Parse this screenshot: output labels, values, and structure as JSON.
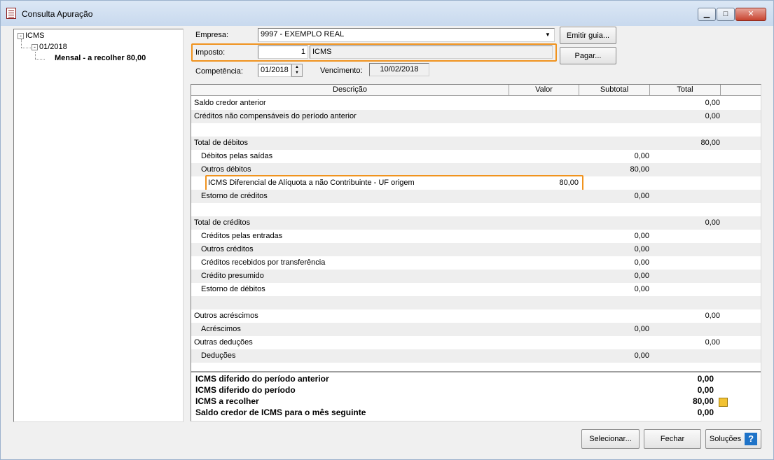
{
  "window": {
    "title": "Consulta Apuração"
  },
  "tree": {
    "root": "ICMS",
    "period": "01/2018",
    "leaf": "Mensal - a recolher 80,00"
  },
  "form": {
    "empresa_label": "Empresa:",
    "empresa_value": "9997 - EXEMPLO REAL",
    "imposto_label": "Imposto:",
    "imposto_code": "1",
    "imposto_name": "ICMS",
    "competencia_label": "Competência:",
    "competencia_value": "01/2018",
    "vencimento_label": "Vencimento:",
    "vencimento_value": "10/02/2018",
    "emitir_guia": "Emitir guia...",
    "pagar": "Pagar..."
  },
  "grid": {
    "columns": [
      "Descrição",
      "Valor",
      "Subtotal",
      "Total"
    ],
    "rows": [
      {
        "desc": "Saldo credor anterior",
        "indent": 0,
        "valor": "",
        "subtotal": "",
        "total": "0,00"
      },
      {
        "desc": "Créditos não compensáveis do período anterior",
        "indent": 0,
        "valor": "",
        "subtotal": "",
        "total": "0,00"
      },
      {
        "desc": "",
        "indent": 0,
        "valor": "",
        "subtotal": "",
        "total": ""
      },
      {
        "desc": "Total de débitos",
        "indent": 0,
        "valor": "",
        "subtotal": "",
        "total": "80,00"
      },
      {
        "desc": "Débitos pelas saídas",
        "indent": 1,
        "valor": "",
        "subtotal": "0,00",
        "total": ""
      },
      {
        "desc": "Outros débitos",
        "indent": 1,
        "valor": "",
        "subtotal": "80,00",
        "total": ""
      },
      {
        "desc": "ICMS Diferencial de Alíquota a não Contribuinte - UF origem",
        "indent": 2,
        "valor": "80,00",
        "subtotal": "",
        "total": ""
      },
      {
        "desc": "Estorno de créditos",
        "indent": 1,
        "valor": "",
        "subtotal": "0,00",
        "total": ""
      },
      {
        "desc": "",
        "indent": 0,
        "valor": "",
        "subtotal": "",
        "total": ""
      },
      {
        "desc": "Total de créditos",
        "indent": 0,
        "valor": "",
        "subtotal": "",
        "total": "0,00"
      },
      {
        "desc": "Créditos pelas entradas",
        "indent": 1,
        "valor": "",
        "subtotal": "0,00",
        "total": ""
      },
      {
        "desc": "Outros créditos",
        "indent": 1,
        "valor": "",
        "subtotal": "0,00",
        "total": ""
      },
      {
        "desc": "Créditos recebidos por transferência",
        "indent": 1,
        "valor": "",
        "subtotal": "0,00",
        "total": ""
      },
      {
        "desc": "Crédito presumido",
        "indent": 1,
        "valor": "",
        "subtotal": "0,00",
        "total": ""
      },
      {
        "desc": "Estorno de débitos",
        "indent": 1,
        "valor": "",
        "subtotal": "0,00",
        "total": ""
      },
      {
        "desc": "",
        "indent": 0,
        "valor": "",
        "subtotal": "",
        "total": ""
      },
      {
        "desc": "Outros acréscimos",
        "indent": 0,
        "valor": "",
        "subtotal": "",
        "total": "0,00"
      },
      {
        "desc": "Acréscimos",
        "indent": 1,
        "valor": "",
        "subtotal": "0,00",
        "total": ""
      },
      {
        "desc": "Outras deduções",
        "indent": 0,
        "valor": "",
        "subtotal": "",
        "total": "0,00"
      },
      {
        "desc": "Deduções",
        "indent": 1,
        "valor": "",
        "subtotal": "0,00",
        "total": ""
      }
    ]
  },
  "summary": [
    {
      "label": "ICMS diferido do período anterior",
      "value": "0,00"
    },
    {
      "label": "ICMS diferido do período",
      "value": "0,00"
    },
    {
      "label": "ICMS a recolher",
      "value": "80,00"
    },
    {
      "label": "Saldo credor de ICMS para o mês seguinte",
      "value": "0,00"
    }
  ],
  "footer": {
    "selecionar": "Selecionar...",
    "fechar": "Fechar",
    "solucoes": "Soluções",
    "help_glyph": "?"
  },
  "colors": {
    "highlight": "#f0931e",
    "accent": "#1e73c8"
  },
  "icons": {
    "window": "document-icon",
    "calculator": "calculator-icon",
    "help": "help-icon"
  }
}
